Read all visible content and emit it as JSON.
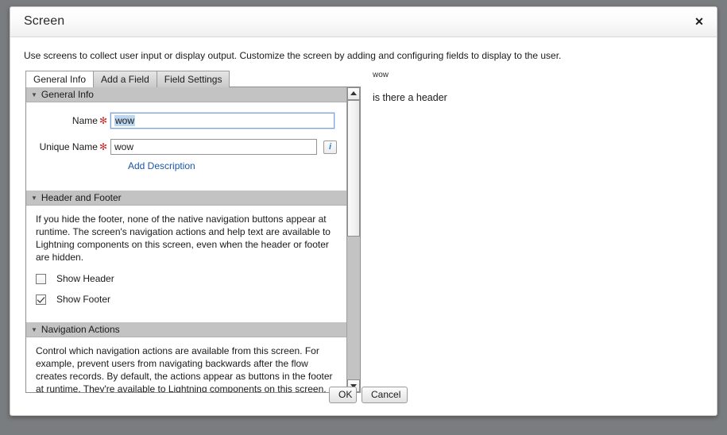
{
  "dialog": {
    "title": "Screen",
    "close_label": "✕",
    "subtitle": "Use screens to collect user input or display output. Customize the screen by adding and configuring fields to display to the user."
  },
  "tabs": [
    {
      "label": "General Info",
      "active": true
    },
    {
      "label": "Add a Field",
      "active": false
    },
    {
      "label": "Field Settings",
      "active": false
    }
  ],
  "sections": {
    "general_info": {
      "header": "General Info",
      "triangle": "▼",
      "name_label": "Name",
      "name_required": "✻",
      "name_value": "wow",
      "unique_label": "Unique Name",
      "unique_required": "✻",
      "unique_value": "wow",
      "info_button": "i",
      "add_description": "Add Description"
    },
    "header_and_footer": {
      "header": "Header and Footer",
      "triangle": "▼",
      "description": "If you hide the footer, none of the native navigation buttons appear at runtime. The screen's navigation actions and help text are available to Lightning components on this screen, even when the header or footer are hidden.",
      "show_header_label": "Show Header",
      "show_header_checked": false,
      "show_footer_label": "Show Footer",
      "show_footer_checked": true
    },
    "navigation_actions": {
      "header": "Navigation Actions",
      "triangle": "▼",
      "description": "Control which navigation actions are available from this screen. For example, prevent users from navigating backwards after the flow creates records. By default, the actions appear as buttons in the footer at runtime. They're available to Lightning components on this screen, even when the footer is hidden."
    }
  },
  "scrollbar": {
    "up_arrow": "▲",
    "down_arrow": "▼"
  },
  "preview": {
    "unique_name_text": "wow",
    "header_text": "is there a header"
  },
  "footer": {
    "ok_label": "OK",
    "cancel_label": "Cancel"
  },
  "colors": {
    "backdrop": "#7a7d80",
    "section_header_bg": "#c3c3c3",
    "link": "#1a56a8",
    "required_asterisk": "#c9302c",
    "focus_border": "#7aa7d8",
    "selection_highlight": "#bcd7f0"
  }
}
